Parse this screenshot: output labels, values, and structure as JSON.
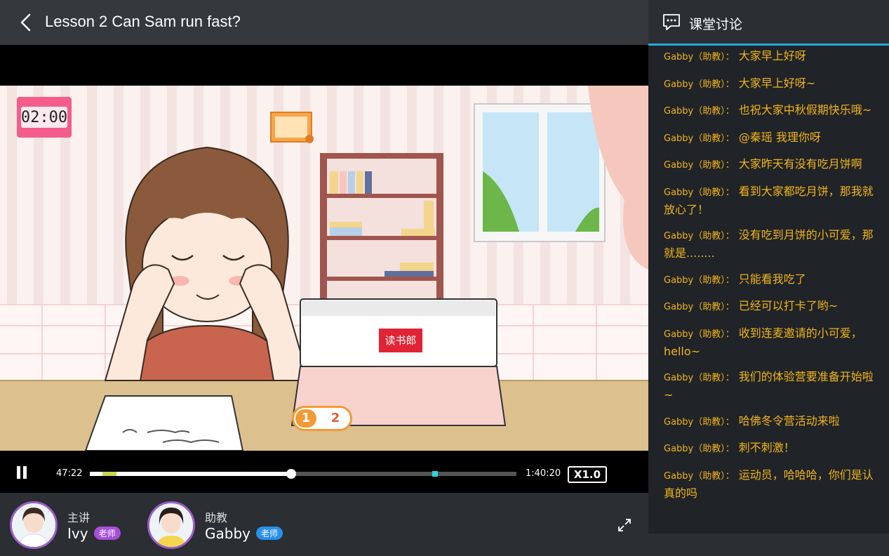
{
  "header": {
    "title": "Lesson 2 Can Sam run fast?"
  },
  "video": {
    "timer": "02:00",
    "laptop_logo": "读书郎",
    "page_buttons": [
      "1",
      "2"
    ]
  },
  "controls": {
    "current_time": "47:22",
    "total_time": "1:40:20",
    "progress_fraction": 0.472,
    "speed": "X1.0"
  },
  "teachers": [
    {
      "role": "主讲",
      "name": "Ivy",
      "badge": "老师",
      "badge_color": "#a64fd8"
    },
    {
      "role": "助教",
      "name": "Gabby",
      "badge": "老师",
      "badge_color": "#2a8fe8"
    }
  ],
  "chat": {
    "title": "课堂讨论",
    "messages": [
      {
        "sender": "Gabby（助教）：",
        "text": "大家早上好呀"
      },
      {
        "sender": "Gabby（助教）：",
        "text": "大家早上好呀~"
      },
      {
        "sender": "Gabby（助教）：",
        "text": "也祝大家中秋假期快乐哦~"
      },
      {
        "sender": "Gabby（助教）：",
        "text": "@秦瑶 我理你呀"
      },
      {
        "sender": "Gabby（助教）：",
        "text": "大家昨天有没有吃月饼啊"
      },
      {
        "sender": "Gabby（助教）：",
        "text": "看到大家都吃月饼，那我就放心了！"
      },
      {
        "sender": "Gabby（助教）：",
        "text": "没有吃到月饼的小可爱，那就是........"
      },
      {
        "sender": "Gabby（助教）：",
        "text": "只能看我吃了"
      },
      {
        "sender": "Gabby（助教）：",
        "text": "已经可以打卡了哟~"
      },
      {
        "sender": "Gabby（助教）：",
        "text": "收到连麦邀请的小可爱，hello~"
      },
      {
        "sender": "Gabby（助教）：",
        "text": "我们的体验营要准备开始啦~"
      },
      {
        "sender": "Gabby（助教）：",
        "text": "哈佛冬令营活动来啦"
      },
      {
        "sender": "Gabby（助教）：",
        "text": "刺不刺激！"
      },
      {
        "sender": "Gabby（助教）：",
        "text": "运动员，哈哈哈，你们是认真的吗"
      }
    ]
  }
}
